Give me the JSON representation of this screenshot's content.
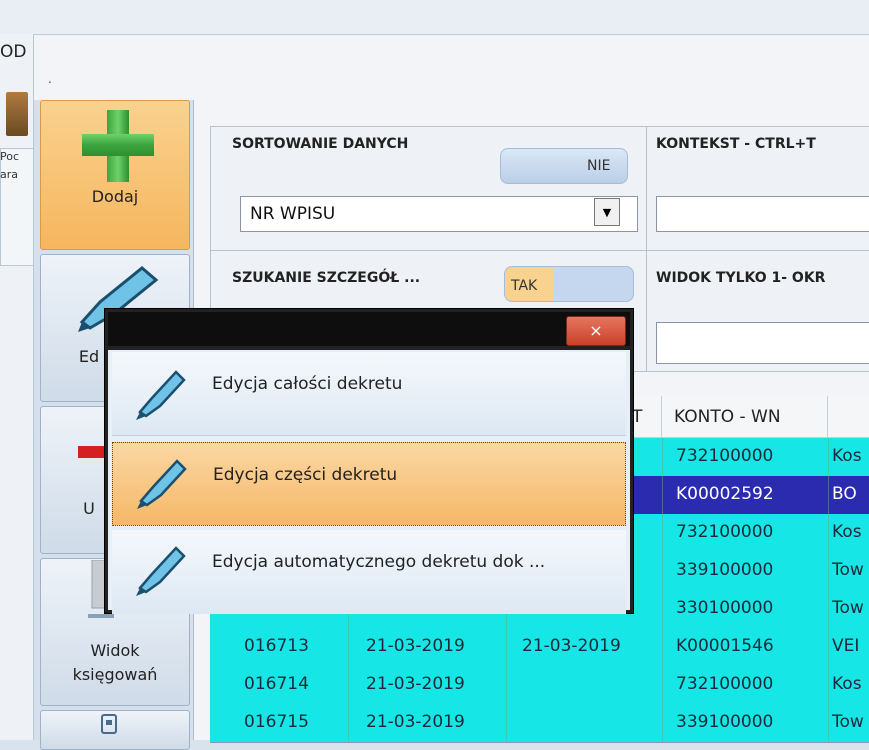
{
  "behind_window": {
    "title_fragment": "OD",
    "label_fragment_1": "Poc",
    "label_fragment_2": "ara"
  },
  "window": {
    "title_dot": "."
  },
  "toolbar": {
    "dodaj_label": "Dodaj",
    "edycja_label": "Ed",
    "usun_label": "U",
    "widok_label_1": "Widok",
    "widok_label_2": "księgowań"
  },
  "filters": {
    "sorting_title": "SORTOWANIE DANYCH",
    "sorting_toggle": "NIE",
    "sorting_value": "NR WPISU",
    "context_title": "KONTEKST -  CTRL+T",
    "search_title": "SZUKANIE SZCZEGÓŁ ...",
    "search_toggle": "TAK",
    "view_title": "WIDOK TYLKO 1- OKR"
  },
  "table": {
    "header_visible": "KONTO - WN",
    "header_partial": "T",
    "rows": [
      {
        "nr": "",
        "date1": "",
        "date2": "",
        "konto": "732100000",
        "desc": "Kos"
      },
      {
        "nr": "",
        "date1": "",
        "date2": "9",
        "konto": "K00002592",
        "desc": "BO"
      },
      {
        "nr": "",
        "date1": "",
        "date2": "",
        "konto": "732100000",
        "desc": "Kos"
      },
      {
        "nr": "",
        "date1": "",
        "date2": "",
        "konto": "339100000",
        "desc": "Tow"
      },
      {
        "nr": "016712",
        "date1": "21-03-2019",
        "date2": "",
        "konto": "330100000",
        "desc": "Tow"
      },
      {
        "nr": "016713",
        "date1": "21-03-2019",
        "date2": "21-03-2019",
        "konto": "K00001546",
        "desc": "VEI"
      },
      {
        "nr": "016714",
        "date1": "21-03-2019",
        "date2": "",
        "konto": "732100000",
        "desc": "Kos"
      },
      {
        "nr": "016715",
        "date1": "21-03-2019",
        "date2": "",
        "konto": "339100000",
        "desc": "Tow"
      }
    ]
  },
  "popup": {
    "close_glyph": "×",
    "items": [
      {
        "label": "Edycja całości dekretu"
      },
      {
        "label": "Edycja części dekretu"
      },
      {
        "label": "Edycja automatycznego dekretu dok ..."
      }
    ]
  },
  "colors": {
    "row_bg": "#17e6e6",
    "selected_row_bg": "#2b2bb0",
    "accent_orange": "#f5b65e",
    "close_red": "#c9412a"
  }
}
